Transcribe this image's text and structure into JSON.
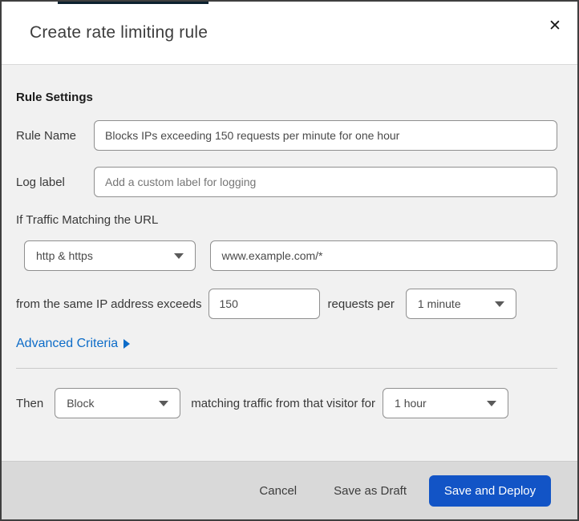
{
  "colors": {
    "top_accent": "#0d2130",
    "link_blue": "#0d6cc8",
    "primary_button": "#1254c6",
    "body_bg": "#f1f1f1",
    "footer_bg": "#d9d9d9"
  },
  "icons": {
    "close": "✕",
    "chevron_down": "css-triangle-down",
    "arrow_right": "css-triangle-right"
  },
  "header": {
    "title": "Create rate limiting rule"
  },
  "form": {
    "section_heading": "Rule Settings",
    "rule_name": {
      "label": "Rule Name",
      "value": "Blocks IPs exceeding 150 requests per minute for one hour"
    },
    "log_label": {
      "label": "Log label",
      "placeholder": "Add a custom label for logging"
    },
    "traffic_match": {
      "heading": "If Traffic Matching the URL",
      "scheme_selected": "http & https",
      "url_value": "www.example.com/*"
    },
    "threshold": {
      "prefix": "from the same IP address exceeds",
      "requests_value": "150",
      "middle": "requests per",
      "period_selected": "1 minute"
    },
    "advanced_criteria_label": "Advanced Criteria",
    "action": {
      "prefix": "Then",
      "action_selected": "Block",
      "middle": "matching traffic from that visitor for",
      "duration_selected": "1 hour"
    }
  },
  "footer": {
    "cancel_label": "Cancel",
    "save_draft_label": "Save as Draft",
    "save_deploy_label": "Save and Deploy"
  }
}
